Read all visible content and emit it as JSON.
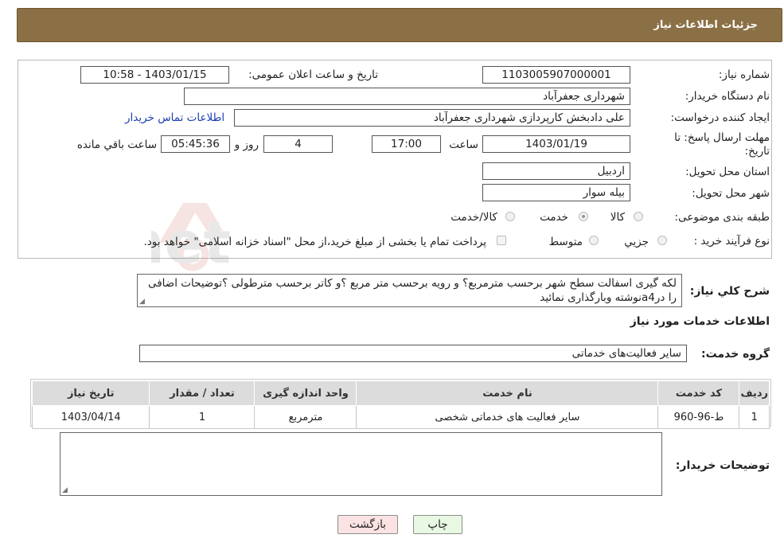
{
  "header": {
    "title": "جزئیات اطلاعات نیاز"
  },
  "form": {
    "need_number": {
      "label": "شماره نیاز:",
      "value": "1103005907000001"
    },
    "announce_datetime": {
      "label": "تاریخ و ساعت اعلان عمومی:",
      "value": "1403/01/15 - 10:58"
    },
    "buyer_org": {
      "label": "نام دستگاه خریدار:",
      "value": "شهرداری جعفرآباد"
    },
    "requester": {
      "label": "ایجاد کننده درخواست:",
      "value": "علی دادبخش کارپردازی شهرداری جعفرآباد",
      "contact_link": "اطلاعات تماس خریدار"
    },
    "deadline": {
      "label": "مهلت ارسال پاسخ: تا تاریخ:",
      "date": "1403/01/19",
      "time_label": "ساعت",
      "time": "17:00",
      "days": "4",
      "days_label": "روز و",
      "remaining": "05:45:36",
      "remaining_label": "ساعت باقي مانده"
    },
    "delivery_province": {
      "label": "استان محل تحویل:",
      "value": "اردبیل"
    },
    "delivery_city": {
      "label": "شهر محل تحویل:",
      "value": "بیله سوار"
    },
    "subject_category": {
      "label": "طبقه بندی موضوعی:",
      "options": [
        {
          "label": "کالا",
          "selected": false
        },
        {
          "label": "خدمت",
          "selected": true
        },
        {
          "label": "کالا/خدمت",
          "selected": false
        }
      ]
    },
    "purchase_process": {
      "label": "نوع فرآیند خرید :",
      "options": [
        {
          "label": "جزیي",
          "selected": false
        },
        {
          "label": "متوسط",
          "selected": false
        }
      ],
      "payment_note": "پرداخت تمام یا بخشی از مبلغ خرید،از محل \"اسناد خزانه اسلامی\" خواهد بود."
    }
  },
  "description": {
    "label": "شرح کلي نياز:",
    "text": "لکه گیری اسفالت سطح شهر برحسب مترمربع؟ و رویه برحسب متر مربع ؟و کاتر برحسب مترطولی ؟توضیحات اضافی را درa4نوشته وبارگذاری نمائید"
  },
  "services_section": {
    "title": "اطلاعات خدمات مورد نياز"
  },
  "service_group": {
    "label": "گروه خدمت:",
    "value": "سایر فعالیت‌های خدماتی"
  },
  "table": {
    "headers": [
      "ردیف",
      "کد خدمت",
      "نام خدمت",
      "واحد اندازه گیری",
      "تعداد / مقدار",
      "تاریخ نیاز"
    ],
    "rows": [
      [
        "1",
        "ط-96-960",
        "سایر فعالیت های خدماتی شخصی",
        "مترمربع",
        "1",
        "1403/04/14"
      ]
    ]
  },
  "buyer_notes": {
    "label": "توضیحات خریدار:",
    "value": ""
  },
  "buttons": {
    "print": "چاپ",
    "back": "بازگشت"
  },
  "watermark": {
    "text": "AriaTender.net"
  }
}
